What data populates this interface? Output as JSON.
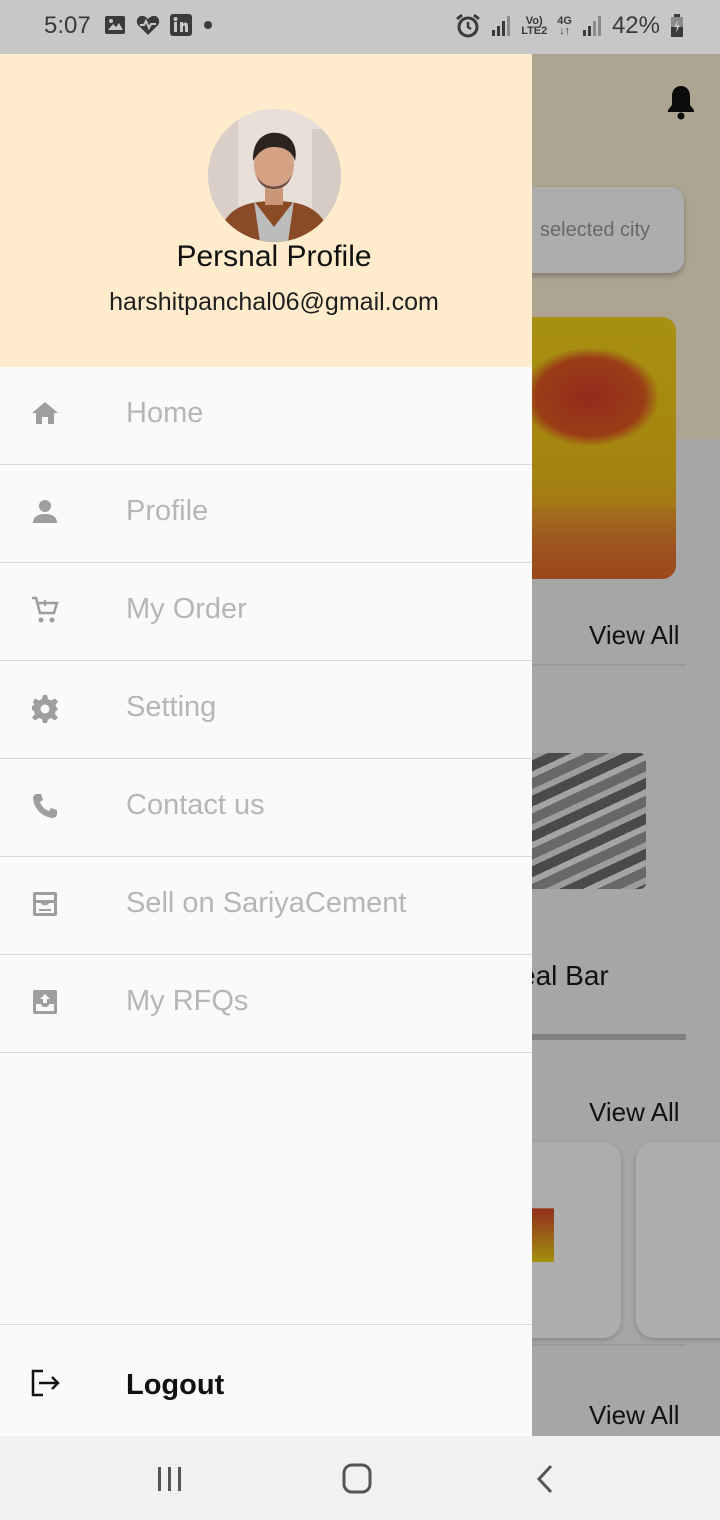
{
  "status_bar": {
    "time": "5:07",
    "battery_percent": "42%",
    "network_volte": "Vo)",
    "network_lte": "LTE2",
    "network_4g": "4G",
    "left_icons": [
      "image-icon",
      "heart-icon",
      "linkedin-icon",
      "dot-icon"
    ],
    "right_icons": [
      "alarm-icon",
      "signal-icon",
      "signal-icon",
      "battery-icon"
    ]
  },
  "background": {
    "city_placeholder": "selected city",
    "view_all_1": "View All",
    "view_all_2": "View All",
    "view_all_3": "View All",
    "product_label": "eal Bar"
  },
  "drawer": {
    "profile_name": "Persnal Profile",
    "profile_email": "harshitpanchal06@gmail.com",
    "menu_items": [
      {
        "label": "Home",
        "icon": "home-icon"
      },
      {
        "label": "Profile",
        "icon": "person-icon"
      },
      {
        "label": "My Order",
        "icon": "cart-icon"
      },
      {
        "label": "Setting",
        "icon": "gear-icon"
      },
      {
        "label": "Contact us",
        "icon": "phone-icon"
      },
      {
        "label": "Sell on SariyaCement",
        "icon": "inbox-icon"
      },
      {
        "label": "My RFQs",
        "icon": "upload-box-icon"
      }
    ],
    "logout_label": "Logout",
    "logout_icon": "logout-icon"
  },
  "nav_bar": {
    "buttons": [
      "recent-apps-icon",
      "home-button-icon",
      "back-icon"
    ]
  },
  "colors": {
    "drawer_header": "#ffeccc",
    "menu_text": "#b6b6b6",
    "logout_text": "#111111"
  }
}
